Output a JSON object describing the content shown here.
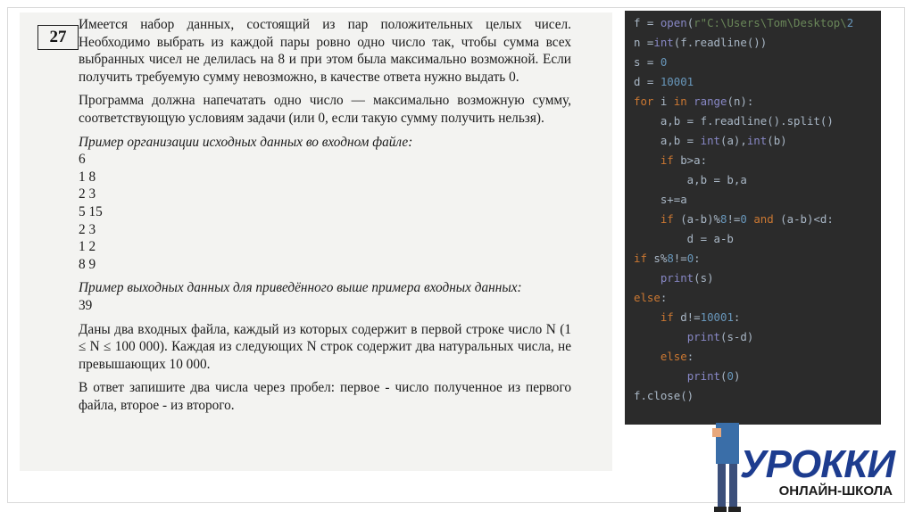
{
  "task": {
    "number": "27",
    "paragraphs": [
      "Имеется набор данных, состоящий из пар положительных целых чисел. Необходимо выбрать из каждой пары ровно одно число так, чтобы сумма всех выбранных чисел не делилась на 8 и при этом была максимально возможной. Если получить требуемую сумму невозможно, в качестве ответа нужно выдать 0.",
      "Программа должна напечатать одно число — максимально возможную сумму, соответствующую условиям задачи (или 0, если такую сумму получить нельзя)."
    ],
    "input_example_heading": "Пример организации исходных данных во входном файле:",
    "input_example": [
      "6",
      "1 8",
      "2 3",
      "5 15",
      "2 3",
      "1 2",
      "8 9"
    ],
    "output_example_heading": "Пример выходных данных для приведённого выше примера входных данных:",
    "output_example": "39",
    "files_paragraph": "Даны два входных файла, каждый из которых содержит в первой строке число N (1 ≤ N ≤ 100 000). Каждая из следующих N строк содержит два натуральных числа, не превышающих 10 000.",
    "answer_paragraph": "В ответ запишите два числа через пробел: первое - число полученное из первого файла, второе - из второго."
  },
  "code": {
    "lines": [
      "f = open(r\"C:\\Users\\Tom\\Desktop\\2",
      "n =int(f.readline())",
      "s = 0",
      "d = 10001",
      "for i in range(n):",
      "    a,b = f.readline().split()",
      "    a,b = int(a),int(b)",
      "    if b>a:",
      "        a,b = b,a",
      "    s+=a",
      "    if (a-b)%8!=0 and (a-b)<d:",
      "        d = a-b",
      "if s%8!=0:",
      "    print(s)",
      "else:",
      "    if d!=10001:",
      "        print(s-d)",
      "    else:",
      "        print(0)",
      "f.close()"
    ]
  },
  "brand": {
    "name": "УРОККИ",
    "subtitle": "ОНЛАЙН-ШКОЛА"
  },
  "colors": {
    "code_bg": "#2b2b2b",
    "code_text": "#a9b7c6",
    "keyword": "#cc7832",
    "number": "#6897bb",
    "builtin": "#8888c6",
    "brand_blue": "#1d3c8f"
  }
}
